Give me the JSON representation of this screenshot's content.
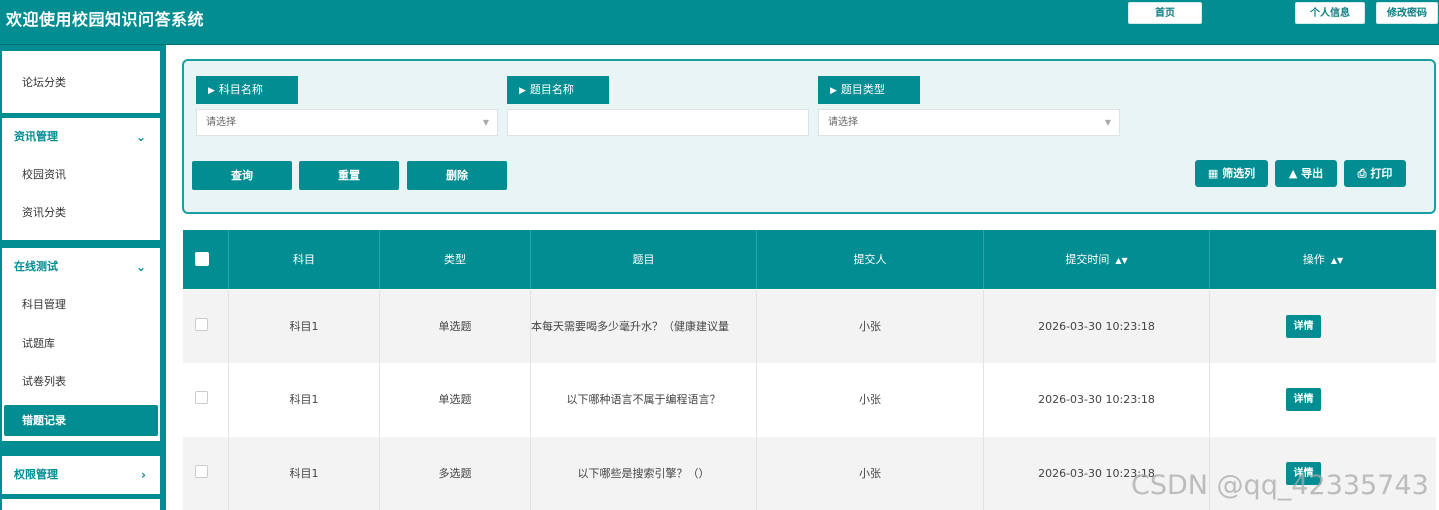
{
  "header": {
    "title": "欢迎使用校园知识问答系统",
    "home_label": "首页",
    "profile_label": "个人信息",
    "password_label": "修改密码"
  },
  "sidebar": {
    "forum_category": "论坛分类",
    "news_group": "资讯管理",
    "news_items": [
      "校园资讯",
      "资讯分类"
    ],
    "test_group": "在线测试",
    "test_items": [
      "科目管理",
      "试题库",
      "试卷列表"
    ],
    "active_item": "错题记录",
    "auth_group": "权限管理"
  },
  "search": {
    "subject_label": "科目名称",
    "subject_placeholder": "请选择",
    "question_label": "题目名称",
    "type_label": "题目类型",
    "type_placeholder": "请选择",
    "query_button": "查询",
    "reset_button": "重置",
    "delete_button": "删除",
    "filter_button": "筛选列",
    "export_button": "导出",
    "print_button": "打印"
  },
  "table": {
    "columns": [
      "科目",
      "类型",
      "题目",
      "提交人",
      "提交时间",
      "操作"
    ],
    "rows": [
      {
        "subject": "科目1",
        "type": "单选题",
        "question": "本每天需要喝多少毫升水？（健康建议量",
        "submitter": "小张",
        "time": "2026-03-30 10:23:18",
        "action": "详情"
      },
      {
        "subject": "科目1",
        "type": "单选题",
        "question": "以下哪种语言不属于编程语言？",
        "submitter": "小张",
        "time": "2026-03-30 10:23:18",
        "action": "详情"
      },
      {
        "subject": "科目1",
        "type": "多选题",
        "question": "以下哪些是搜索引擎？（）",
        "submitter": "小张",
        "time": "2026-03-30 10:23:18",
        "action": "详情"
      }
    ]
  },
  "watermark": "CSDN @qq_42335743",
  "colors": {
    "primary": "#028d92",
    "panel_bg": "#e9f5f5"
  }
}
